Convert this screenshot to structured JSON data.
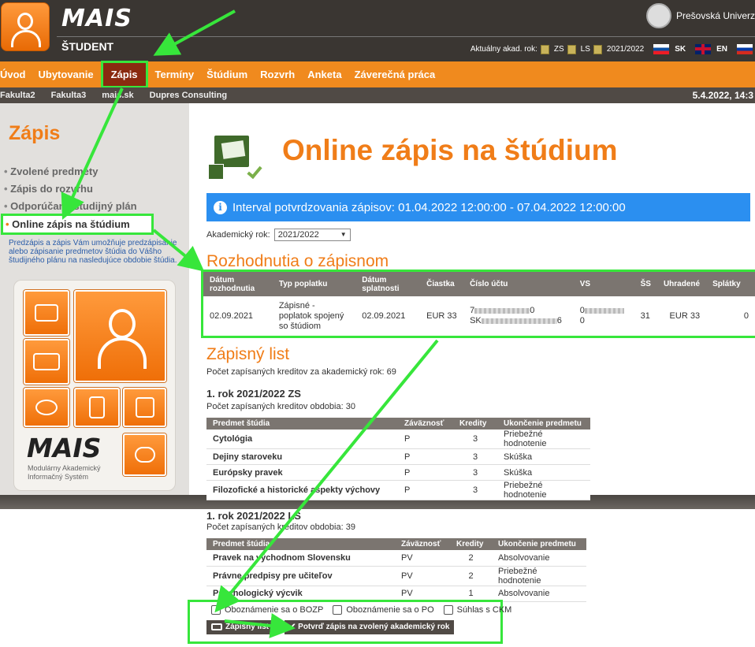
{
  "header": {
    "app_name": "MAIS",
    "subtitle": "ŠTUDENT",
    "university": "Prešovská Univerz",
    "academic_year_label": "Aktuálny akad. rok:",
    "semester_zs": "ZS",
    "semester_ls": "LS",
    "year": "2021/2022",
    "lang_sk": "SK",
    "lang_en": "EN"
  },
  "menu": {
    "items": [
      "Úvod",
      "Ubytovanie",
      "Zápis",
      "Termíny",
      "Štúdium",
      "Rozvrh",
      "Anketa",
      "Záverečná práca"
    ],
    "active": "Zápis"
  },
  "submenu": {
    "items": [
      "Fakulta2",
      "Fakulta3",
      "mais.sk",
      "Dupres Consulting"
    ],
    "datetime": "5.4.2022, 14:3"
  },
  "sidebar": {
    "title": "Zápis",
    "items": [
      "Zvolené predmety",
      "Zápis do rozvrhu",
      "Odporúčaný študijný plán",
      "Online zápis na štúdium"
    ],
    "active_item": "Online zápis na štúdium",
    "description": "Predzápis a zápis Vám umožňuje predzápisanie alebo zápisanie predmetov štúdia do Vášho študijného plánu na nasledujúce obdobie štúdia.",
    "logo_text": "MAIS",
    "logo_sub": "Modulárny Akademický Informačný Systém"
  },
  "main": {
    "title": "Online zápis na štúdium",
    "info": "Interval potvrdzovania zápisov: 01.04.2022 12:00:00 - 07.04.2022 12:00:00",
    "year_label": "Akademický rok:",
    "year_value": "2021/2022",
    "decisions": {
      "title": "Rozhodnutia o zápisnom",
      "headers": [
        "Dátum rozhodnutia",
        "Typ poplatku",
        "Dátum splatnosti",
        "Čiastka",
        "Číslo účtu",
        "VS",
        "ŠS",
        "Uhradené",
        "Splátky"
      ],
      "row": {
        "date": "02.09.2021",
        "type": "Zápisné - poplatok spojený so štúdiom",
        "due": "02.09.2021",
        "amount": "EUR 33",
        "account_1a": "7",
        "account_1b": "0",
        "account_2a": "SK",
        "account_2b": "6",
        "vs_a": "0",
        "vs_b": "0",
        "ss": "31",
        "paid": "EUR 33",
        "installments": "0"
      }
    },
    "enrollment": {
      "title": "Zápisný list",
      "total_credits": "Počet zapísaných kreditov za akademický rok: 69",
      "headers": [
        "Predmet štúdia",
        "Záväznosť",
        "Kredity",
        "Ukončenie predmetu"
      ],
      "terms": [
        {
          "title": "1. rok 2021/2022 ZS",
          "credits": "Počet zapísaných kreditov obdobia: 30",
          "rows": [
            {
              "name": "Cytológia",
              "type": "P",
              "credits": "3",
              "end": "Priebežné hodnotenie"
            },
            {
              "name": "Dejiny staroveku",
              "type": "P",
              "credits": "3",
              "end": "Skúška"
            },
            {
              "name": "Európsky pravek",
              "type": "P",
              "credits": "3",
              "end": "Skúška"
            },
            {
              "name": "Filozofické a historické aspekty výchovy",
              "type": "P",
              "credits": "3",
              "end": "Priebežné hodnotenie"
            }
          ]
        },
        {
          "title": "1. rok 2021/2022 LS",
          "credits": "Počet zapísaných kreditov obdobia: 39",
          "rows": [
            {
              "name": "Pravek na východnom Slovensku",
              "type": "PV",
              "credits": "2",
              "end": "Absolvovanie"
            },
            {
              "name": "Právne predpisy pre učiteľov",
              "type": "PV",
              "credits": "2",
              "end": "Priebežné hodnotenie"
            },
            {
              "name": "Psychologický výcvik",
              "type": "PV",
              "credits": "1",
              "end": "Absolvovanie"
            }
          ]
        }
      ]
    },
    "checkboxes": [
      "Oboznámenie sa o BOZP",
      "Oboznámenie sa o PO",
      "Súhlas s CKM"
    ],
    "btn_list": "Zápisný list",
    "btn_confirm": "✔ Potvrď zápis na zvolený akademický rok"
  },
  "colors": {
    "accent": "#f07d18",
    "header_bg": "#3a3632",
    "info_blue": "#2b8ff0",
    "annotation_green": "#37e63b",
    "table_header": "#7b7570"
  }
}
